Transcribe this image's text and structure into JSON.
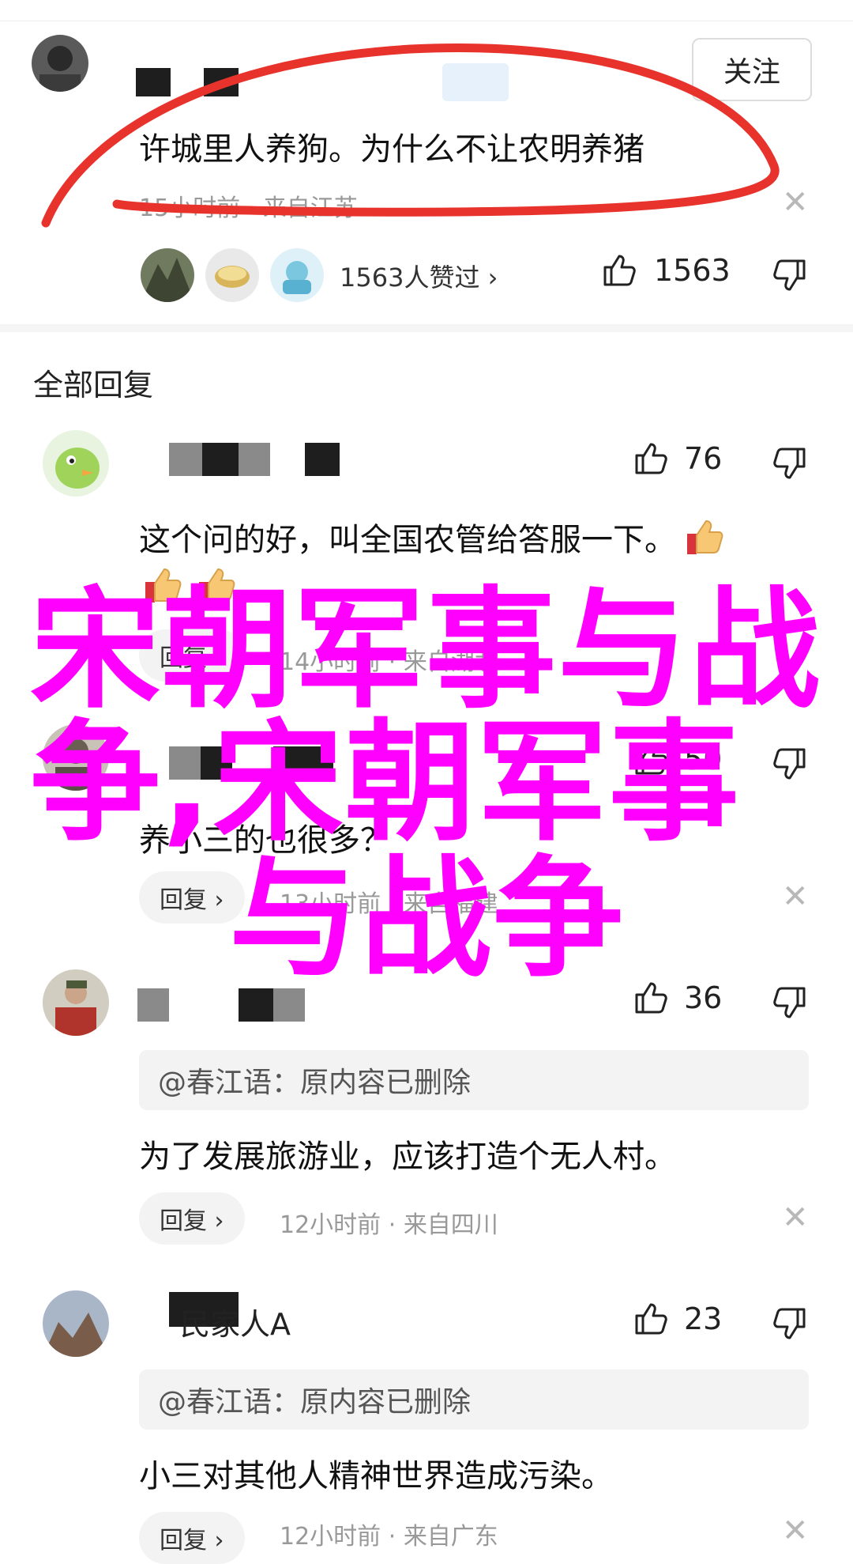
{
  "main_comment": {
    "follow_label": "关注",
    "text": "许城里人养狗。为什么不让农明养猪",
    "time": "15小时前",
    "location": "来自江苏",
    "likers_text": "1563人赞过 ›",
    "like_count": "1563"
  },
  "section_title": "全部回复",
  "replies": [
    {
      "like_count": "76",
      "text": "这个问的好，叫全国农管给答服一下。",
      "reply_label": "回复 ›",
      "time": "14小时前",
      "location": "来自湖北"
    },
    {
      "like_count": "50",
      "text": "养小三的也很多？",
      "reply_label": "回复 ›",
      "time": "13小时前",
      "location": "来自福建"
    },
    {
      "like_count": "36",
      "quote": "@春江语：原内容已删除",
      "text": "为了发展旅游业，应该打造个无人村。",
      "reply_label": "回复 ›",
      "time": "12小时前",
      "location": "来自四川"
    },
    {
      "name_suffix": "民家人A",
      "like_count": "23",
      "quote": "@春江语：原内容已删除",
      "text": "小三对其他人精神世界造成污染。",
      "reply_label": "回复 ›",
      "time": "12小时前",
      "location": "来自广东"
    }
  ],
  "overlay": {
    "line1": "宋朝军事与战",
    "line2": "争,宋朝军事",
    "line3": "与战争"
  },
  "colors": {
    "overlay": "#ff00ff",
    "annotation_red": "#e8332d",
    "meta_grey": "#999999"
  }
}
